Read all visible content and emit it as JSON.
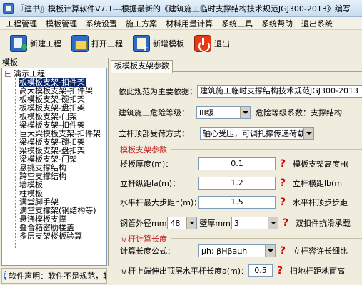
{
  "window": {
    "title": "『建书』模板计算软件V7.1---根据最新的《建筑施工临时支撑结构技术规范JGJ300-2013》编写"
  },
  "menu": [
    "工程管理",
    "模板管理",
    "系统设置",
    "施工方案",
    "材料用量计算",
    "系统工具",
    "系统帮助",
    "退出系统"
  ],
  "toolbar": {
    "new_project": "新建工程",
    "open_project": "打开工程",
    "add_template": "新增模板",
    "exit": "退出"
  },
  "left_panel": {
    "title": "模板",
    "root": "演示工程",
    "items": [
      "板模板支架-扣件架",
      "高大模板支架-扣件架",
      "板模板支架-碗扣架",
      "板模板支架-盘扣架",
      "板模板支架-门架",
      "梁模板支架-扣件架",
      "巨大梁模板支架-扣件架",
      "梁模板支架-碗扣架",
      "梁模板支架-盘扣架",
      "梁模板支架-门架",
      "悬挑支撑结构",
      "跨空支撑结构",
      "墙模板",
      "柱模板",
      "满堂脚手架",
      "满堂支撑架(钢结构等)",
      "悬浇模板支撑",
      "叠合箱密肋楼盖",
      "多层支架楼板验算"
    ],
    "selected_index": 0,
    "status": "软件声明：软件不是规范，软件只是工具，最终的计算结果请用户自行审核"
  },
  "tab": {
    "label": "板模板支架参数"
  },
  "form": {
    "basis_label": "依此规范为主要依据：",
    "basis_value": "建筑施工临时支撑结构技术规范JGJ300-2013",
    "hazard_label": "建筑施工危险等级：",
    "hazard_value": "III级",
    "hazard_coef_label": "危险等级系数：支撑结构",
    "top_force_label": "立杆顶部受荷方式：",
    "top_force_value": "轴心受压，可调托撑传递荷载",
    "group1_title": "模板支架参数",
    "thickness_label": "楼板厚度(m)：",
    "thickness_value": "0.1",
    "height_label": "模板支架高度H(",
    "la_label": "立杆纵距la(m)：",
    "la_value": "1.2",
    "lb_label": "立杆横距lb(m",
    "step_label": "水平杆最大步距h(m)：",
    "step_value": "1.5",
    "top_step_label": "水平杆顶步步距",
    "pipe_label": "钢管外径mm",
    "pipe_value": "48",
    "wall_label": "壁厚mm",
    "wall_value": "3",
    "fastener_label": "双扣件抗滑承载",
    "group2_title": "立杆计算长度",
    "calc_label": "计算长度公式：",
    "calc_value": "μh; βHβaμh",
    "slender_label": "立杆容许长细比",
    "ext_label": "立杆上端伸出顶层水平杆长度a(m)：",
    "ext_value": "0.5",
    "sweep_label": "扫地杆距地面高"
  }
}
